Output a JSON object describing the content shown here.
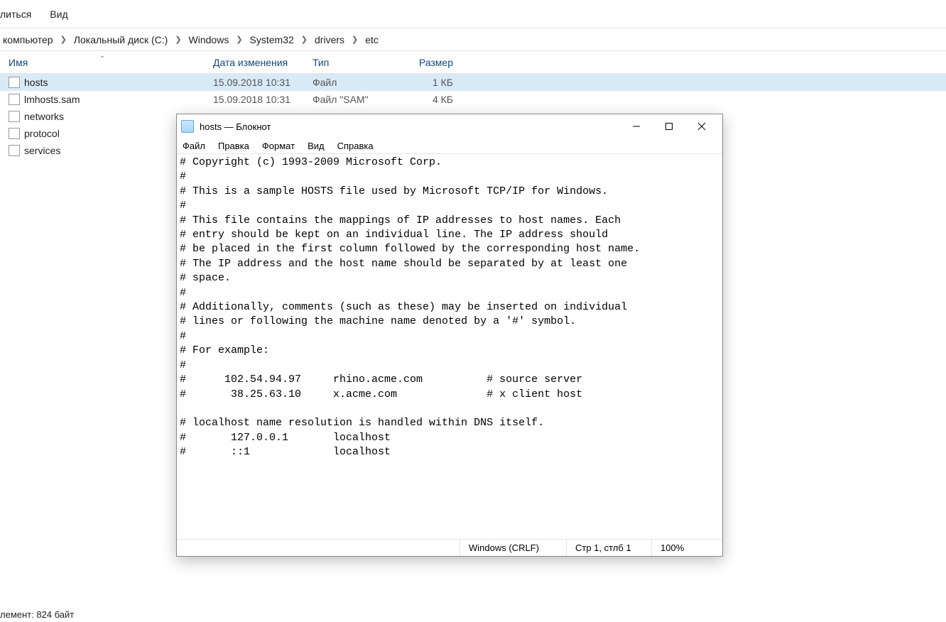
{
  "explorer": {
    "menu": {
      "share": "литься",
      "view": "Вид"
    },
    "breadcrumb": [
      "компьютер",
      "Локальный диск (C:)",
      "Windows",
      "System32",
      "drivers",
      "etc"
    ],
    "columns": {
      "name": "Имя",
      "date": "Дата изменения",
      "type": "Тип",
      "size": "Размер"
    },
    "files": [
      {
        "name": "hosts",
        "date": "15.09.2018 10:31",
        "type": "Файл",
        "size": "1 КБ",
        "selected": true
      },
      {
        "name": "lmhosts.sam",
        "date": "15.09.2018 10:31",
        "type": "Файл \"SAM\"",
        "size": "4 КБ",
        "selected": false
      },
      {
        "name": "networks",
        "date": "",
        "type": "",
        "size": "",
        "selected": false
      },
      {
        "name": "protocol",
        "date": "",
        "type": "",
        "size": "",
        "selected": false
      },
      {
        "name": "services",
        "date": "",
        "type": "",
        "size": "",
        "selected": false
      }
    ],
    "statusbar": "лемент: 824 байт"
  },
  "notepad": {
    "title": "hosts — Блокнот",
    "menu": {
      "file": "Файл",
      "edit": "Правка",
      "format": "Формат",
      "view": "Вид",
      "help": "Справка"
    },
    "content": "# Copyright (c) 1993-2009 Microsoft Corp.\n#\n# This is a sample HOSTS file used by Microsoft TCP/IP for Windows.\n#\n# This file contains the mappings of IP addresses to host names. Each\n# entry should be kept on an individual line. The IP address should\n# be placed in the first column followed by the corresponding host name.\n# The IP address and the host name should be separated by at least one\n# space.\n#\n# Additionally, comments (such as these) may be inserted on individual\n# lines or following the machine name denoted by a '#' symbol.\n#\n# For example:\n#\n#      102.54.94.97     rhino.acme.com          # source server\n#       38.25.63.10     x.acme.com              # x client host\n\n# localhost name resolution is handled within DNS itself.\n#\t127.0.0.1       localhost\n#\t::1             localhost",
    "status": {
      "encoding": "Windows (CRLF)",
      "pos": "Стр 1, стлб 1",
      "zoom": "100%"
    }
  }
}
